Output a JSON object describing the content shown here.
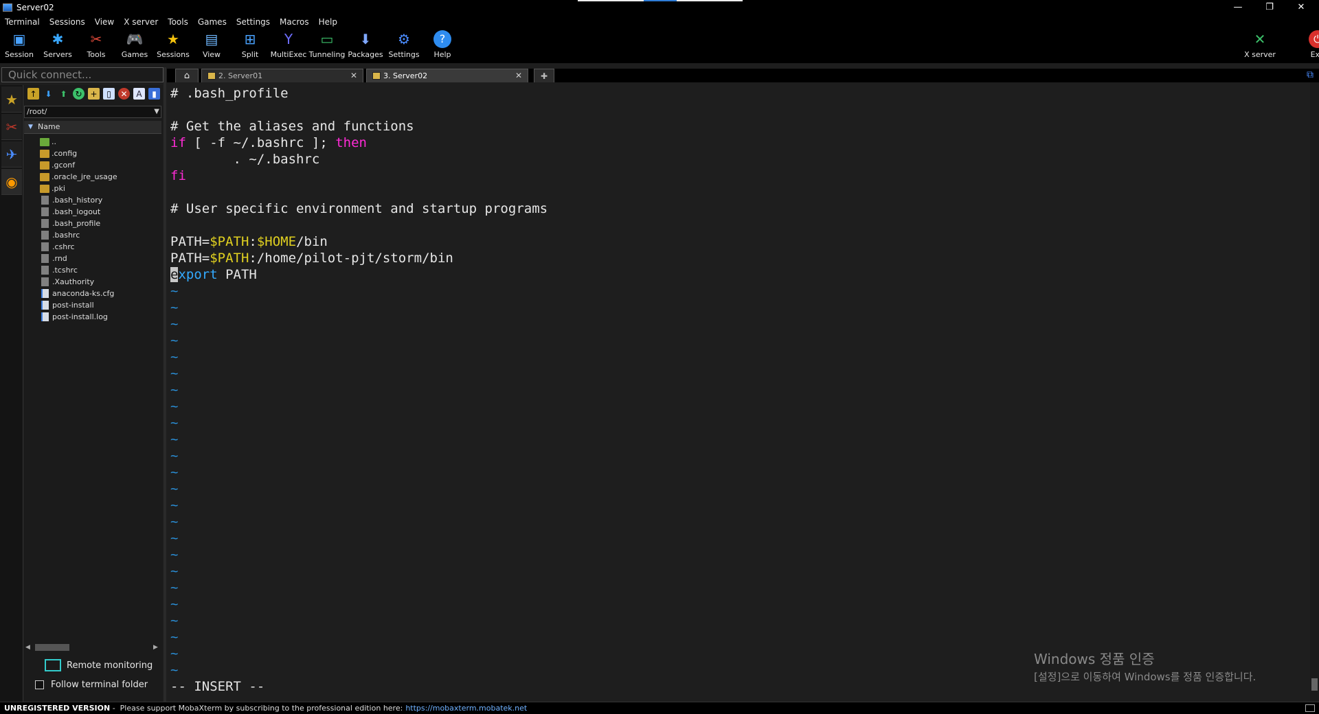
{
  "window": {
    "title": "Server02"
  },
  "menu": [
    "Terminal",
    "Sessions",
    "View",
    "X server",
    "Tools",
    "Games",
    "Settings",
    "Macros",
    "Help"
  ],
  "toolbar": {
    "left": [
      {
        "label": "Session",
        "icon": "session-icon",
        "glyph": "▣",
        "color": "#4aa3ff"
      },
      {
        "label": "Servers",
        "icon": "servers-icon",
        "glyph": "✱",
        "color": "#39a8ff"
      },
      {
        "label": "Tools",
        "icon": "tools-icon",
        "glyph": "✂",
        "color": "#e24a3a"
      },
      {
        "label": "Games",
        "icon": "games-icon",
        "glyph": "🎮",
        "color": "#cfcfcf"
      },
      {
        "label": "Sessions",
        "icon": "star-icon",
        "glyph": "★",
        "color": "#f4c20d"
      },
      {
        "label": "View",
        "icon": "view-icon",
        "glyph": "▤",
        "color": "#6fb8ff"
      },
      {
        "label": "Split",
        "icon": "split-icon",
        "glyph": "⊞",
        "color": "#4aa3ff"
      },
      {
        "label": "MultiExec",
        "icon": "multiexec-icon",
        "glyph": "Y",
        "color": "#6d6dff"
      },
      {
        "label": "Tunneling",
        "icon": "tunneling-icon",
        "glyph": "▭",
        "color": "#3cc06a"
      },
      {
        "label": "Packages",
        "icon": "packages-icon",
        "glyph": "⬇",
        "color": "#7fa8ff"
      },
      {
        "label": "Settings",
        "icon": "settings-icon",
        "glyph": "⚙",
        "color": "#4a8cff"
      },
      {
        "label": "Help",
        "icon": "help-icon",
        "glyph": "?",
        "color": "#ffffff"
      }
    ],
    "right": [
      {
        "label": "X server",
        "icon": "xserver-icon",
        "glyph": "✕",
        "color": "#3cc06a"
      },
      {
        "label": "Exit",
        "icon": "exit-icon",
        "glyph": "⏻",
        "color": "#ffffff"
      }
    ]
  },
  "quick_connect": {
    "placeholder": "Quick connect..."
  },
  "file_browser": {
    "path": "/root/",
    "column_header": "Name",
    "files": [
      {
        "name": "..",
        "type": "up"
      },
      {
        "name": ".config",
        "type": "folder"
      },
      {
        "name": ".gconf",
        "type": "folder"
      },
      {
        "name": ".oracle_jre_usage",
        "type": "folder"
      },
      {
        "name": ".pki",
        "type": "folder"
      },
      {
        "name": ".bash_history",
        "type": "file"
      },
      {
        "name": ".bash_logout",
        "type": "file"
      },
      {
        "name": ".bash_profile",
        "type": "file"
      },
      {
        "name": ".bashrc",
        "type": "file"
      },
      {
        "name": ".cshrc",
        "type": "file"
      },
      {
        "name": ".rnd",
        "type": "file"
      },
      {
        "name": ".tcshrc",
        "type": "file"
      },
      {
        "name": ".Xauthority",
        "type": "file"
      },
      {
        "name": "anaconda-ks.cfg",
        "type": "doc"
      },
      {
        "name": "post-install",
        "type": "doc"
      },
      {
        "name": "post-install.log",
        "type": "doc"
      }
    ],
    "remote_monitoring": "Remote monitoring",
    "follow_terminal_folder": "Follow terminal folder"
  },
  "tabs": [
    {
      "label": "2. Server01",
      "active": false
    },
    {
      "label": "3. Server02",
      "active": true
    }
  ],
  "terminal": {
    "lines": [
      "# .bash_profile",
      "",
      "# Get the aliases and functions",
      "if [ -f ~/.bashrc ]; then",
      "        . ~/.bashrc",
      "fi",
      "",
      "# User specific environment and startup programs",
      "",
      "PATH=$PATH:$HOME/bin",
      "PATH=$PATH:/home/pilot-pjt/storm/bin",
      "export PATH"
    ],
    "tilde": "~",
    "tilde_count": 24,
    "mode": "-- INSERT --"
  },
  "watermark": {
    "line1": "Windows 정품 인증",
    "line2": "[설정]으로 이동하여 Windows를 정품 인증합니다."
  },
  "statusbar": {
    "unregistered": "UNREGISTERED VERSION",
    "message": " -  Please support MobaXterm by subscribing to the professional edition here:",
    "link": "https://mobaxterm.mobatek.net"
  }
}
